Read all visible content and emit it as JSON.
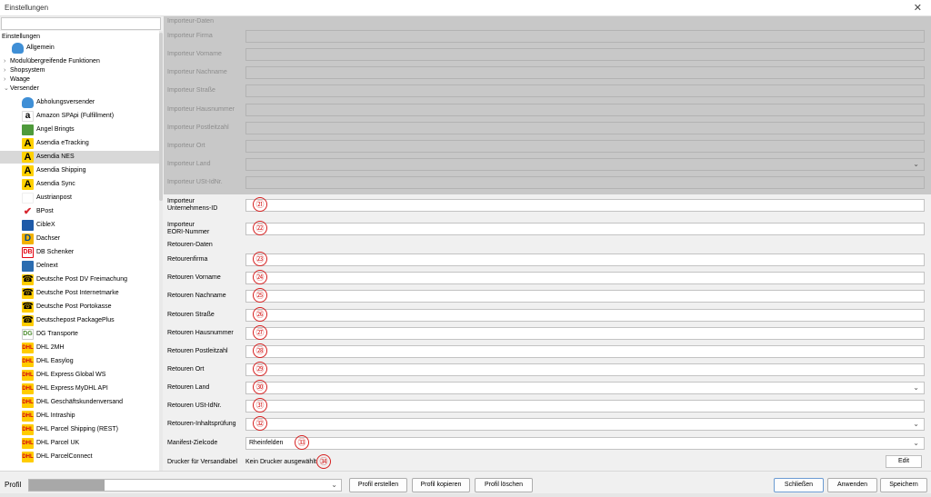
{
  "window": {
    "title": "Einstellungen",
    "close_glyph": "✕"
  },
  "tree": {
    "root": "Einstellungen",
    "items": [
      {
        "label": "Allgemein",
        "icon": "cloud-icon"
      },
      {
        "label": "Modulübergreifende Funktionen",
        "caret": "›"
      },
      {
        "label": "Shopsystem",
        "caret": "›"
      },
      {
        "label": "Waage",
        "caret": "›"
      },
      {
        "label": "Versender",
        "caret": "⌄"
      },
      {
        "label": "Abholungsversender",
        "icon": "cloud-icon"
      },
      {
        "label": "Amazon SPApi (Fulfillment)",
        "icon": "amazon-logo-icon",
        "glyph": "a"
      },
      {
        "label": "Angel Bringts",
        "icon": "angel-logo-icon"
      },
      {
        "label": "Asendia eTracking",
        "icon": "asendia-logo-icon",
        "glyph": "A"
      },
      {
        "label": "Asendia NES",
        "icon": "asendia-logo-icon",
        "glyph": "A",
        "selected": true
      },
      {
        "label": "Asendia Shipping",
        "icon": "asendia-logo-icon",
        "glyph": "A"
      },
      {
        "label": "Asendia Sync",
        "icon": "asendia-logo-icon",
        "glyph": "A"
      },
      {
        "label": "Austrianpost",
        "icon": "austrianpost-logo-icon"
      },
      {
        "label": "BPost",
        "icon": "bpost-logo-icon",
        "glyph": "✔"
      },
      {
        "label": "CibleX",
        "icon": "ciblex-logo-icon"
      },
      {
        "label": "Dachser",
        "icon": "dachser-logo-icon",
        "glyph": "D"
      },
      {
        "label": "DB Schenker",
        "icon": "db-logo-icon",
        "glyph": "DB"
      },
      {
        "label": "Delnext",
        "icon": "delnext-logo-icon"
      },
      {
        "label": "Deutsche Post DV Freimachung",
        "icon": "deutsche-post-horn-icon",
        "glyph": "☎"
      },
      {
        "label": "Deutsche Post Internetmarke",
        "icon": "deutsche-post-horn-icon",
        "glyph": "☎"
      },
      {
        "label": "Deutsche Post Portokasse",
        "icon": "deutsche-post-horn-icon",
        "glyph": "☎"
      },
      {
        "label": "Deutschepost PackagePlus",
        "icon": "deutsche-post-horn-icon",
        "glyph": "☎"
      },
      {
        "label": "DG Transporte",
        "icon": "dg-logo-icon",
        "glyph": "DG"
      },
      {
        "label": "DHL 2MH",
        "icon": "dhl-logo-icon",
        "glyph": "DHL"
      },
      {
        "label": "DHL Easylog",
        "icon": "dhl-logo-icon",
        "glyph": "DHL"
      },
      {
        "label": "DHL Express Global WS",
        "icon": "dhl-logo-icon",
        "glyph": "DHL"
      },
      {
        "label": "DHL Express MyDHL API",
        "icon": "dhl-logo-icon",
        "glyph": "DHL"
      },
      {
        "label": "DHL Geschäftskundenversand",
        "icon": "dhl-logo-icon",
        "glyph": "DHL"
      },
      {
        "label": "DHL Intraship",
        "icon": "dhl-logo-icon",
        "glyph": "DHL"
      },
      {
        "label": "DHL Parcel Shipping (REST)",
        "icon": "dhl-logo-icon",
        "glyph": "DHL"
      },
      {
        "label": "DHL Parcel UK",
        "icon": "dhl-logo-icon",
        "glyph": "DHL"
      },
      {
        "label": "DHL ParcelConnect",
        "icon": "dhl-logo-icon",
        "glyph": "DHL"
      }
    ]
  },
  "form": {
    "importer_section": "Importeur-Daten",
    "disabled_rows": [
      {
        "label": "Importeur Firma"
      },
      {
        "label": "Importeur Vorname"
      },
      {
        "label": "Importeur Nachname"
      },
      {
        "label": "Importeur Straße"
      },
      {
        "label": "Importeur Hausnummer"
      },
      {
        "label": "Importeur Postleitzahl"
      },
      {
        "label": "Importeur Ort"
      },
      {
        "label": "Importeur Land",
        "dropdown": true
      },
      {
        "label": "Importeur USt-IdNr."
      }
    ],
    "rows": [
      {
        "label": "Importeur\nUnternehmens-ID",
        "two_line": true,
        "marker": "㉑"
      },
      {
        "label": "Importeur\nEORI-Nummer",
        "two_line": true,
        "marker": "㉒"
      }
    ],
    "return_section": "Retouren-Daten",
    "return_rows": [
      {
        "label": "Retourenfirma",
        "marker": "㉓"
      },
      {
        "label": "Retouren Vorname",
        "marker": "㉔"
      },
      {
        "label": "Retouren Nachname",
        "marker": "㉕"
      },
      {
        "label": "Retouren Straße",
        "marker": "㉖"
      },
      {
        "label": "Retouren Hausnummer",
        "marker": "㉗"
      },
      {
        "label": "Retouren Postleitzahl",
        "marker": "㉘"
      },
      {
        "label": "Retouren Ort",
        "marker": "㉙"
      },
      {
        "label": "Retouren Land",
        "marker": "㉚",
        "dropdown": true
      },
      {
        "label": "Retouren USt-IdNr.",
        "marker": "㉛"
      },
      {
        "label": "Retouren-Inhaltsprüfung",
        "marker": "㉜",
        "dropdown": true
      },
      {
        "label": "Manifest-Zielcode",
        "marker": "㉝",
        "dropdown": true,
        "value": "Rheinfelden"
      }
    ],
    "printer": {
      "label": "Drucker für Versandlabel",
      "value": "Kein Drucker ausgewählt",
      "marker": "㉞",
      "edit_label": "Edit"
    }
  },
  "footer": {
    "profile_label": "Profil",
    "buttons": {
      "create": "Profil erstellen",
      "copy": "Profil kopieren",
      "delete": "Profil löschen",
      "close": "Schließen",
      "apply": "Anwenden",
      "save": "Speichern"
    }
  },
  "icons": {
    "chevron": "⌄"
  }
}
